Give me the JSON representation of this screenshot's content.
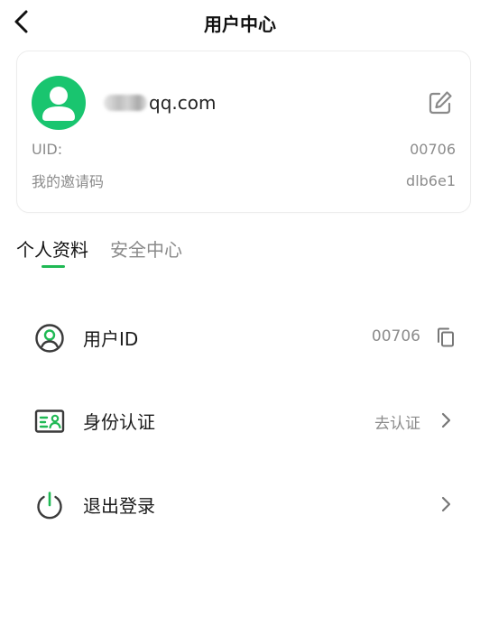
{
  "header": {
    "title": "用户中心",
    "back_icon": "chevron-left-icon"
  },
  "profile": {
    "email_suffix": "qq.com",
    "avatar_icon": "user-avatar-icon",
    "avatar_color": "#19c56f",
    "edit_icon": "edit-icon",
    "uid_label": "UID:",
    "uid_value": "00706",
    "invite_label": "我的邀请码",
    "invite_value": "dlb6e1"
  },
  "tabs": [
    {
      "label": "个人资料",
      "active": true
    },
    {
      "label": "安全中心",
      "active": false
    }
  ],
  "accent_color": "#1fb954",
  "menu": [
    {
      "label": "用户ID",
      "value": "00706",
      "icon": "user-circle-icon",
      "action_icon": "copy-icon"
    },
    {
      "label": "身份认证",
      "value": "去认证",
      "icon": "id-card-icon",
      "action_icon": "chevron-right-icon"
    },
    {
      "label": "退出登录",
      "value": "",
      "icon": "power-icon",
      "action_icon": "chevron-right-icon"
    }
  ]
}
